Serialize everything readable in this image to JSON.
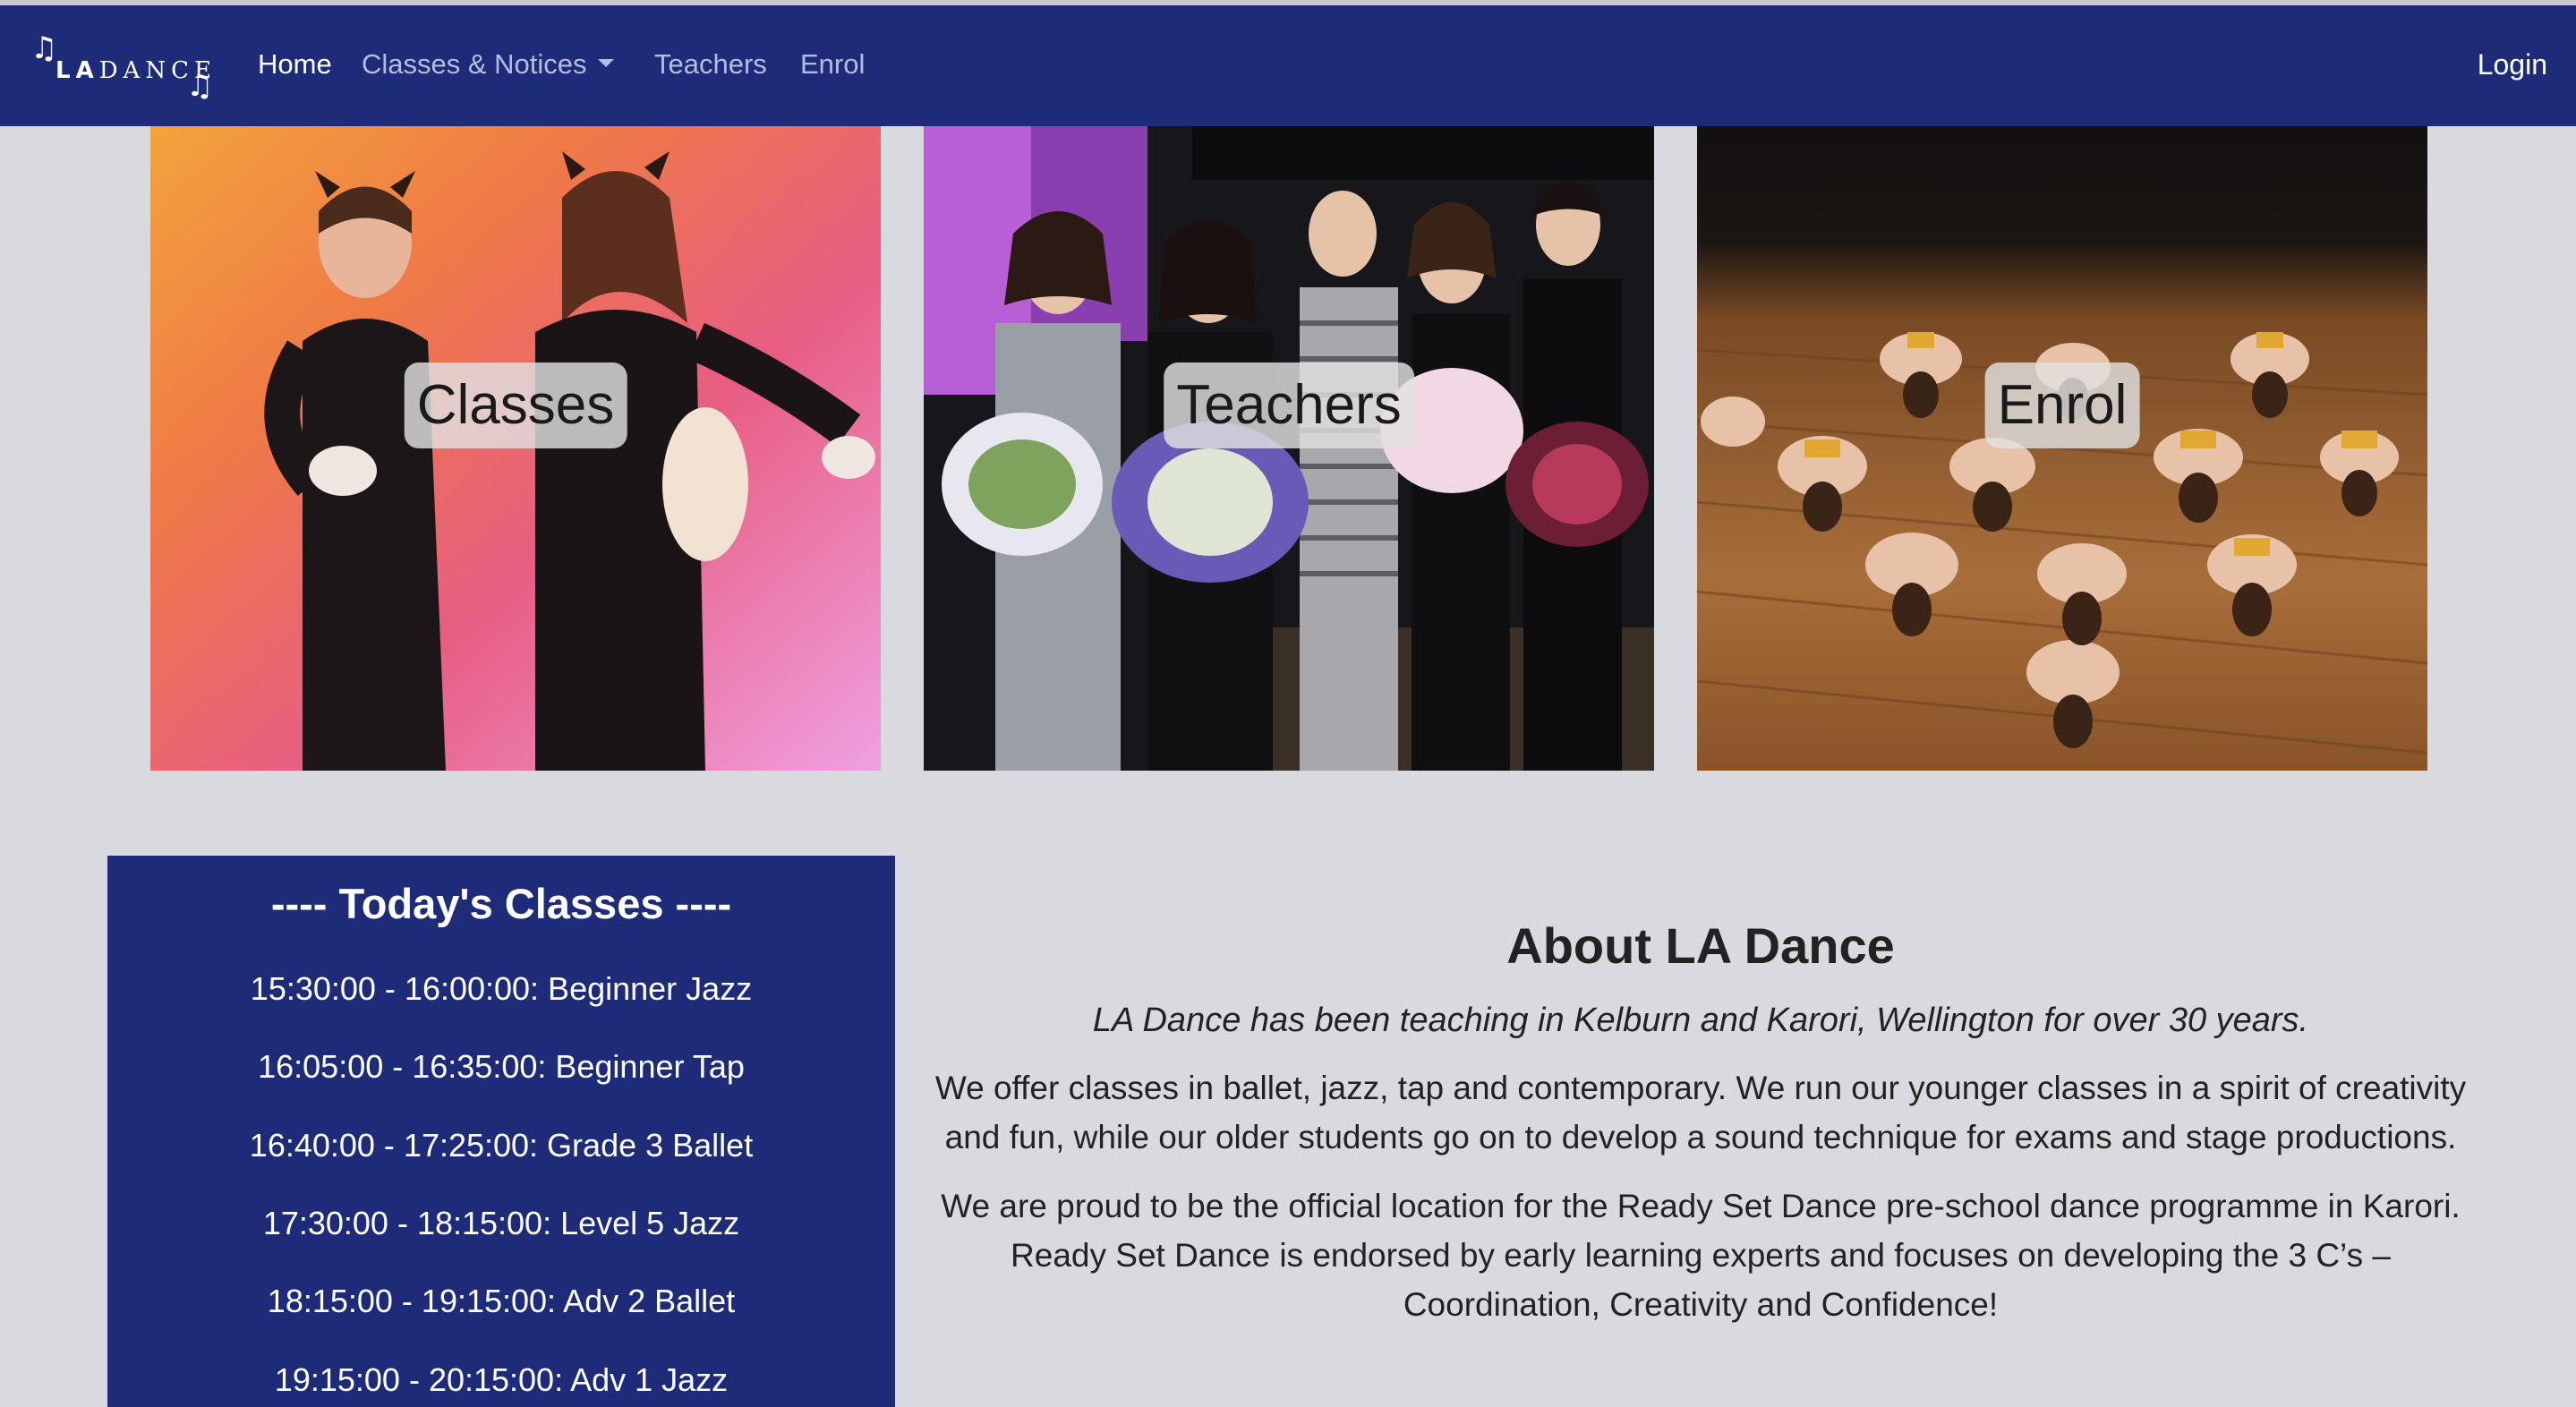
{
  "nav": {
    "logo_text_bold": "LA",
    "logo_text_light": "DANCE",
    "items": [
      {
        "label": "Home"
      },
      {
        "label": "Classes & Notices"
      },
      {
        "label": "Teachers"
      },
      {
        "label": "Enrol"
      }
    ],
    "login": "Login"
  },
  "tiles": [
    {
      "label": "Classes"
    },
    {
      "label": "Teachers"
    },
    {
      "label": "Enrol"
    }
  ],
  "todays_classes": {
    "title": "---- Today's Classes ----",
    "items": [
      "15:30:00 - 16:00:00: Beginner Jazz",
      "16:05:00 - 16:35:00: Beginner Tap",
      "16:40:00 - 17:25:00: Grade 3 Ballet",
      "17:30:00 - 18:15:00: Level 5 Jazz",
      "18:15:00 - 19:15:00: Adv 2 Ballet",
      "19:15:00 - 20:15:00: Adv 1 Jazz"
    ]
  },
  "about": {
    "title": "About LA Dance",
    "intro": "LA Dance has been teaching in Kelburn and Karori, Wellington for over 30 years.",
    "paragraphs": [
      "We offer classes in ballet, jazz, tap and contemporary. We run our younger classes in a spirit of creativity and fun, while our older students go on to develop a sound technique for exams and stage productions.",
      "We are proud to be the official location for the Ready Set Dance pre-school dance programme in Karori. Ready Set Dance is endorsed by early learning experts and focuses on developing the 3 C’s – Coordination, Creativity and Confidence!"
    ]
  }
}
